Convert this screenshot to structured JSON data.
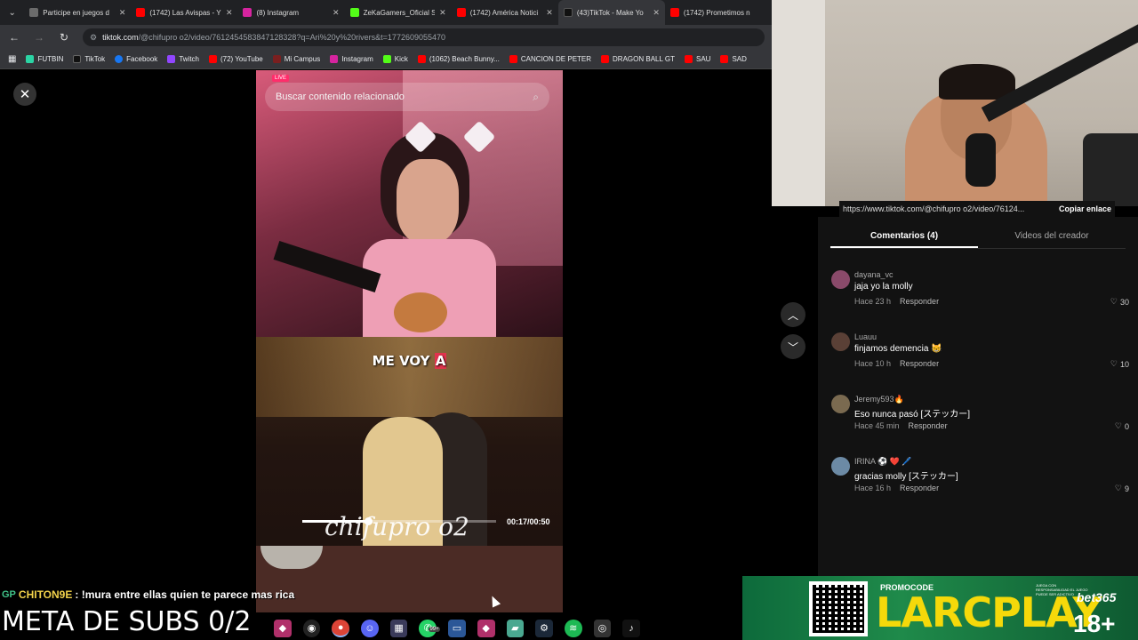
{
  "tabs": [
    {
      "label": "Participe en juegos d",
      "color": "#6b6b6b"
    },
    {
      "label": "(1742) Las Avispas - Y",
      "color": "#ff0000"
    },
    {
      "label": "(8) Instagram",
      "color": "#d6249f"
    },
    {
      "label": "ZeKaGamers_Oficial S",
      "color": "#53fc18"
    },
    {
      "label": "(1742) América Notici",
      "color": "#ff0000"
    },
    {
      "label": "(43)TikTok - Make Yo",
      "color": "#111111"
    },
    {
      "label": "(1742) Prometimos n",
      "color": "#ff0000"
    }
  ],
  "address": {
    "host": "tiktok.com",
    "path": "/@chifupro o2/video/7612454583847128328?q=Ari%20y%20rivers&t=1772609055470"
  },
  "bookmarks": [
    {
      "label": "FUTBIN",
      "color": "#2bd4a4"
    },
    {
      "label": "TikTok",
      "color": "#111111"
    },
    {
      "label": "Facebook",
      "color": "#1877f2"
    },
    {
      "label": "Twitch",
      "color": "#9146ff"
    },
    {
      "label": "(72) YouTube",
      "color": "#ff0000"
    },
    {
      "label": "Mi Campus",
      "color": "#7a1f1f"
    },
    {
      "label": "Instagram",
      "color": "#d6249f"
    },
    {
      "label": "Kick",
      "color": "#53fc18"
    },
    {
      "label": "(1062) Beach Bunny...",
      "color": "#ff0000"
    },
    {
      "label": "CANCION DE PETER",
      "color": "#ff0000"
    },
    {
      "label": "DRAGON BALL GT",
      "color": "#ff0000"
    },
    {
      "label": "SAU",
      "color": "#ff0000"
    },
    {
      "label": "SAD",
      "color": "#ff0000"
    }
  ],
  "video": {
    "live_label": "LIVE",
    "search_placeholder": "Buscar contenido relacionado",
    "caption_pre": "ME VOY ",
    "caption_hl": "A",
    "watermark": "chifupro o2",
    "timecode": "00:17/00:50",
    "progress": 0.34
  },
  "share": {
    "link": "https://www.tiktok.com/@chifupro o2/video/76124...",
    "copy_label": "Copiar enlace"
  },
  "panel": {
    "tab_comments": "Comentarios (4)",
    "tab_videos": "Videos del creador",
    "comments": [
      {
        "user": "dayana_vc",
        "text": "jaja yo la molly",
        "time": "Hace 23 h",
        "reply": "Responder",
        "likes": "30",
        "avatar": "#8a4a6a"
      },
      {
        "user": "Luauu",
        "text": "finjamos demencia 😸",
        "time": "Hace 10 h",
        "reply": "Responder",
        "likes": "10",
        "avatar": "#5a4036"
      },
      {
        "user": "Jeremy593🔥",
        "text": "Eso nunca pasó [ステッカー]",
        "time": "Hace 45 min",
        "reply": "Responder",
        "likes": "0",
        "avatar": "#7a6a50"
      },
      {
        "user": "IRINA ⚽ ❤️ 🖊️",
        "text": "gracias molly [ステッカー]",
        "time": "Hace 16 h",
        "reply": "Responder",
        "likes": "9",
        "avatar": "#6c8aa5"
      }
    ]
  },
  "overlay": {
    "chat_prefix": "GP",
    "chat_name": "CHITON9E",
    "chat_msg": ": !mura entre ellas quien te parece mas rica",
    "meta_subs": "META DE SUBS 0/2"
  },
  "taskbar": {
    "whatsapp_badge": "99+"
  },
  "ad": {
    "promo_label": "PROMOCODE",
    "code": "LARCPLAY",
    "brand": "bet365",
    "age": "18+",
    "fine": "JUEGA CON RESPONSABILIDAD EL JUEGO PUEDE SER ADICTIVO"
  }
}
